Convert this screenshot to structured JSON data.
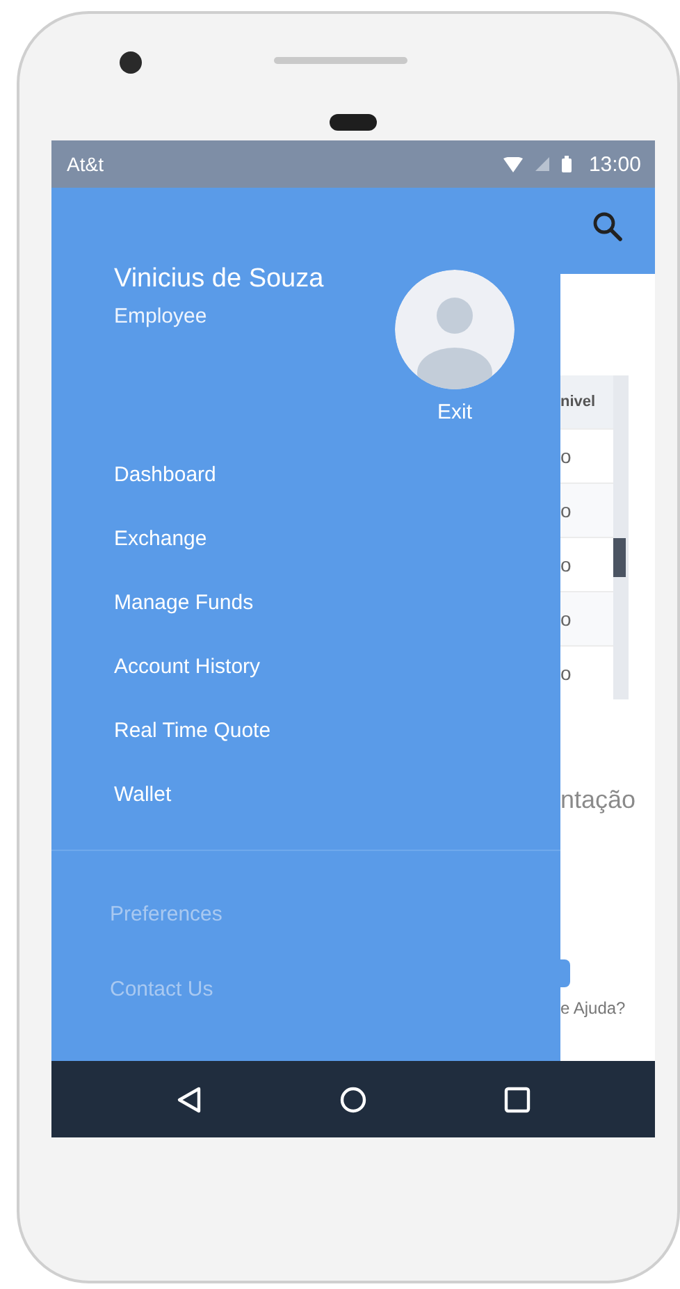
{
  "status_bar": {
    "carrier": "At&t",
    "time": "13:00"
  },
  "drawer": {
    "user": {
      "name": "Vinicius de Souza",
      "role": "Employee"
    },
    "exit_label": "Exit",
    "menu": [
      {
        "label": "Dashboard",
        "disabled": false
      },
      {
        "label": "Exchange",
        "disabled": false
      },
      {
        "label": "Manage Funds",
        "disabled": false
      },
      {
        "label": "Account History",
        "disabled": false
      },
      {
        "label": "Real Time Quote",
        "disabled": false
      },
      {
        "label": "Wallet",
        "disabled": false
      }
    ],
    "secondary_menu": [
      {
        "label": "Preferences",
        "disabled": true
      },
      {
        "label": "Contact Us",
        "disabled": true
      }
    ]
  },
  "background_page": {
    "table": {
      "column_header": "nivel",
      "cells": [
        "o",
        "o",
        "o",
        "o",
        "o"
      ]
    },
    "heading": "ntação",
    "help_link": "e Ajuda?"
  }
}
